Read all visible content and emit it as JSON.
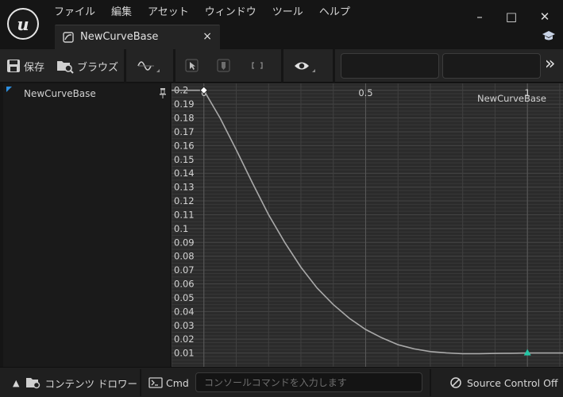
{
  "menu": {
    "items": [
      {
        "label": "ファイル"
      },
      {
        "label": "編集"
      },
      {
        "label": "アセット"
      },
      {
        "label": "ウィンドウ"
      },
      {
        "label": "ツール"
      },
      {
        "label": "ヘルプ"
      }
    ]
  },
  "window": {
    "minimize": "–",
    "maximize": "□",
    "close": "✕"
  },
  "tab": {
    "label": "NewCurveBase",
    "close": "×"
  },
  "toolbar": {
    "save_label": "保存",
    "browse_label": "ブラウズ",
    "expand_glyph": "»"
  },
  "curve_list": {
    "item_label": "NewCurveBase"
  },
  "chart_data": {
    "type": "line",
    "title": "NewCurveBase",
    "xlim": [
      -0.1,
      1.11
    ],
    "ylim": [
      0.0,
      0.205
    ],
    "x_ticks": [
      {
        "value": 0,
        "label": "0"
      },
      {
        "value": 0.5,
        "label": "0.5"
      },
      {
        "value": 1,
        "label": "1"
      }
    ],
    "y_ticks": [
      {
        "value": 0.2,
        "label": "0.2"
      },
      {
        "value": 0.19,
        "label": "0.19"
      },
      {
        "value": 0.18,
        "label": "0.18"
      },
      {
        "value": 0.17,
        "label": "0.17"
      },
      {
        "value": 0.16,
        "label": "0.16"
      },
      {
        "value": 0.15,
        "label": "0.15"
      },
      {
        "value": 0.14,
        "label": "0.14"
      },
      {
        "value": 0.13,
        "label": "0.13"
      },
      {
        "value": 0.12,
        "label": "0.12"
      },
      {
        "value": 0.11,
        "label": "0.11"
      },
      {
        "value": 0.1,
        "label": "0.1"
      },
      {
        "value": 0.09,
        "label": "0.09"
      },
      {
        "value": 0.08,
        "label": "0.08"
      },
      {
        "value": 0.07,
        "label": "0.07"
      },
      {
        "value": 0.06,
        "label": "0.06"
      },
      {
        "value": 0.05,
        "label": "0.05"
      },
      {
        "value": 0.04,
        "label": "0.04"
      },
      {
        "value": 0.03,
        "label": "0.03"
      },
      {
        "value": 0.02,
        "label": "0.02"
      },
      {
        "value": 0.01,
        "label": "0.01"
      }
    ],
    "series": [
      {
        "x": [
          0,
          0.05,
          0.1,
          0.15,
          0.2,
          0.25,
          0.3,
          0.35,
          0.4,
          0.45,
          0.5,
          0.55,
          0.6,
          0.65,
          0.7,
          0.75,
          0.8,
          0.85,
          0.9,
          0.95,
          1.0,
          1.11
        ],
        "y": [
          0.2,
          0.18,
          0.157,
          0.133,
          0.11,
          0.09,
          0.072,
          0.057,
          0.045,
          0.035,
          0.027,
          0.021,
          0.016,
          0.013,
          0.011,
          0.0101,
          0.0095,
          0.0095,
          0.0097,
          0.0098,
          0.01,
          0.01
        ]
      }
    ],
    "keys": [
      {
        "x": 0,
        "y": 0.2,
        "shape": "diamond",
        "color": "#ffffff"
      },
      {
        "x": 1,
        "y": 0.01,
        "shape": "triangle",
        "color": "#26c6a6"
      }
    ],
    "grid": true,
    "curve_color": "#a9a9a9"
  },
  "statusbar": {
    "content_drawer_label": "コンテンツ ドロワー",
    "cmd_label": "Cmd",
    "console_placeholder": "コンソールコマンドを入力します",
    "source_control_label": "Source Control Off"
  }
}
